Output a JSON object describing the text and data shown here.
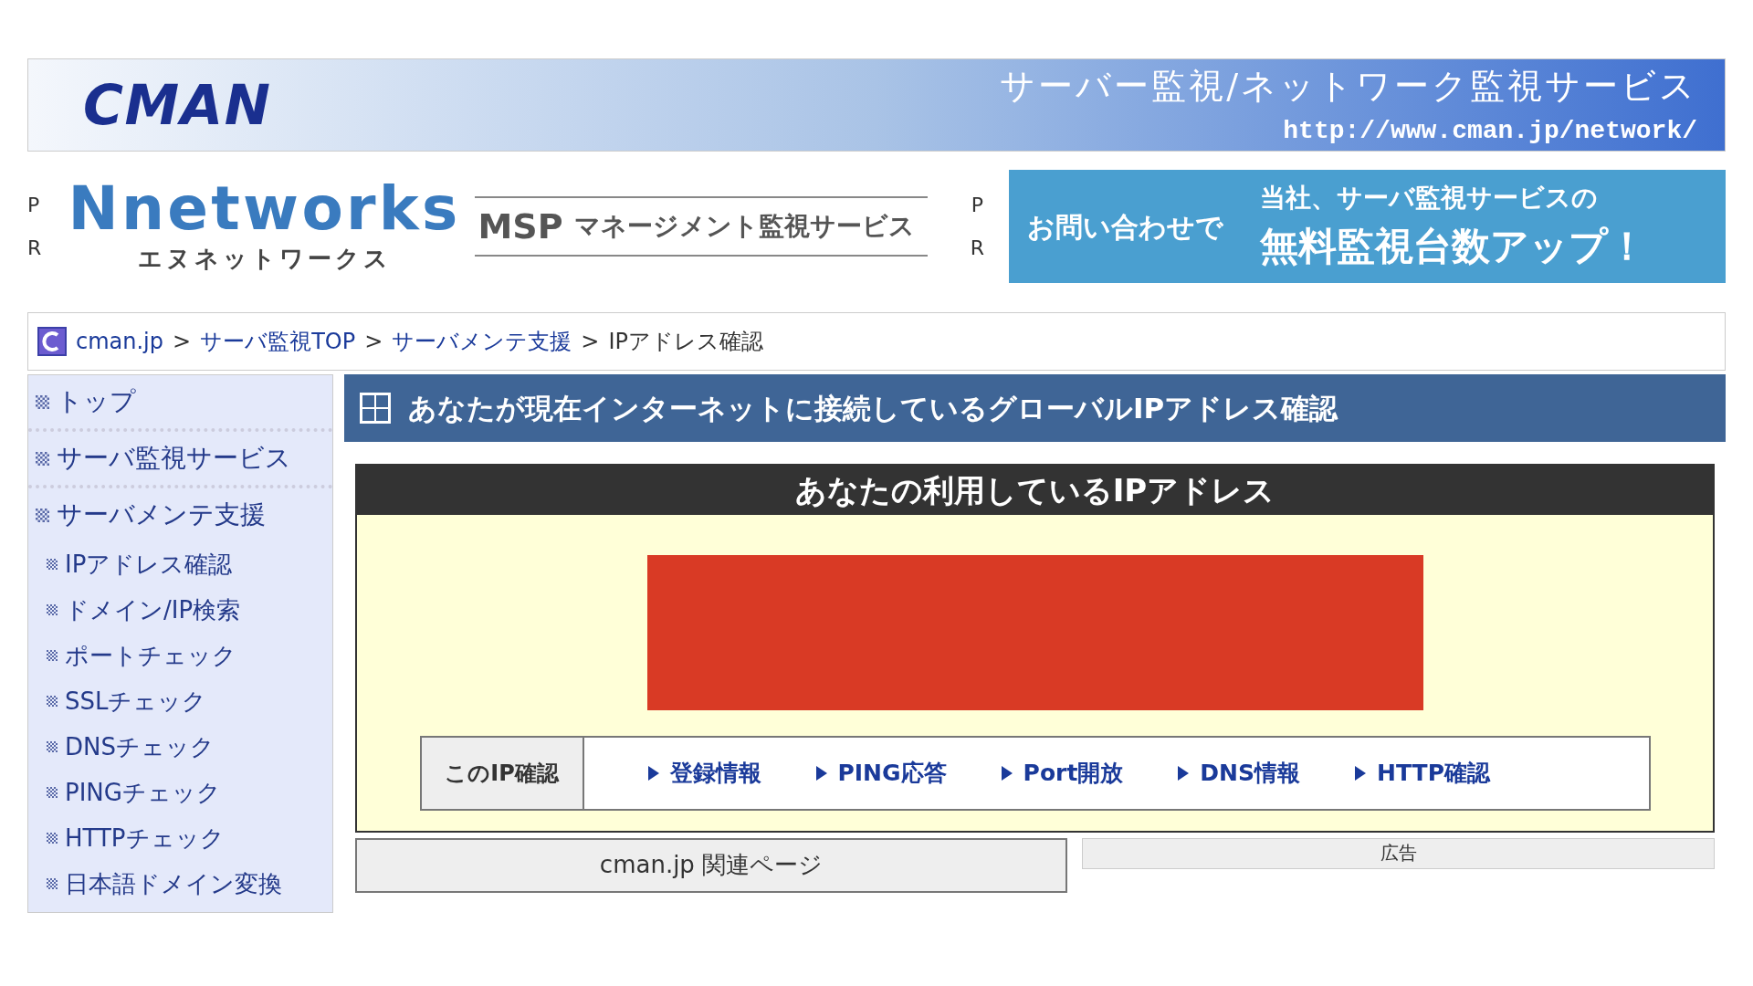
{
  "banner": {
    "logo": "CMAN",
    "title": "サーバー監視/ネットワーク監視サービス",
    "url": "http://www.cman.jp/network/"
  },
  "pr_left": {
    "pr": [
      "P",
      "R"
    ],
    "brand": "Nnetworks",
    "brand_sub": "エヌネットワークス",
    "service": "MSP",
    "service_text": "マネージメント監視サービス"
  },
  "pr_right": {
    "pr": [
      "P",
      "R"
    ],
    "lead": "お問い合わせで",
    "line1": "当社、サーバ監視サービスの",
    "line2": "無料監視台数アップ！"
  },
  "breadcrumb": [
    {
      "label": "cman.jp",
      "kind": "link"
    },
    {
      "label": "サーバ監視TOP",
      "kind": "link"
    },
    {
      "label": "サーバメンテ支援",
      "kind": "link"
    },
    {
      "label": "IPアドレス確認",
      "kind": "current"
    }
  ],
  "breadcrumb_separator": ">",
  "sidebar": {
    "items": [
      {
        "label": "トップ"
      },
      {
        "label": "サーバ監視サービス"
      },
      {
        "label": "サーバメンテ支援",
        "children": [
          {
            "label": "IPアドレス確認"
          },
          {
            "label": "ドメイン/IP検索"
          },
          {
            "label": "ポートチェック"
          },
          {
            "label": "SSLチェック"
          },
          {
            "label": "DNSチェック"
          },
          {
            "label": "PINGチェック"
          },
          {
            "label": "HTTPチェック"
          },
          {
            "label": "日本語ドメイン変換"
          }
        ]
      }
    ]
  },
  "main": {
    "title": "あなたが現在インターネットに接続しているグローバルIPアドレス確認",
    "ip_box": {
      "heading": "あなたの利用しているIPアドレス",
      "check_label": "このIP確認",
      "links": [
        "登録情報",
        "PING応答",
        "Port開放",
        "DNS情報",
        "HTTP確認"
      ]
    },
    "related": {
      "heading": "cman.jp 関連ページ"
    },
    "ad": {
      "heading": "広告"
    }
  }
}
